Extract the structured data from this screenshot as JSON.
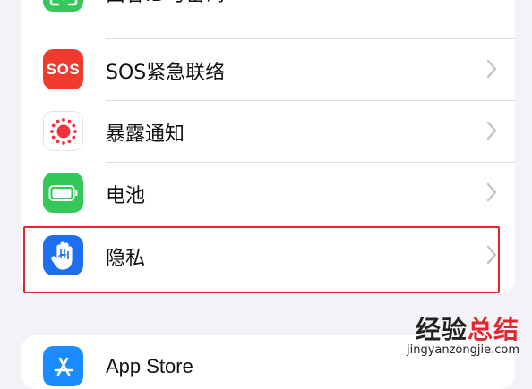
{
  "settings": {
    "items": [
      {
        "label": "面容ID与密码",
        "icon": "face-id-icon",
        "color": "#34c759"
      },
      {
        "label": "SOS紧急联络",
        "icon": "sos-icon",
        "icon_text": "SOS",
        "color": "#f03a2e"
      },
      {
        "label": "暴露通知",
        "icon": "exposure-notification-icon",
        "color": "#ffffff"
      },
      {
        "label": "电池",
        "icon": "battery-icon",
        "color": "#34c759"
      },
      {
        "label": "隐私",
        "icon": "privacy-hand-icon",
        "color": "#1d6ff0"
      }
    ],
    "second_group": [
      {
        "label": "App Store",
        "icon": "app-store-icon",
        "color": "#1a8cff"
      }
    ]
  },
  "watermark": {
    "cn_a": "经验",
    "cn_b": "总结",
    "url": "jingyanzongjie.com"
  },
  "colors": {
    "highlight": "#e4252d",
    "background": "#f2f2f7"
  }
}
